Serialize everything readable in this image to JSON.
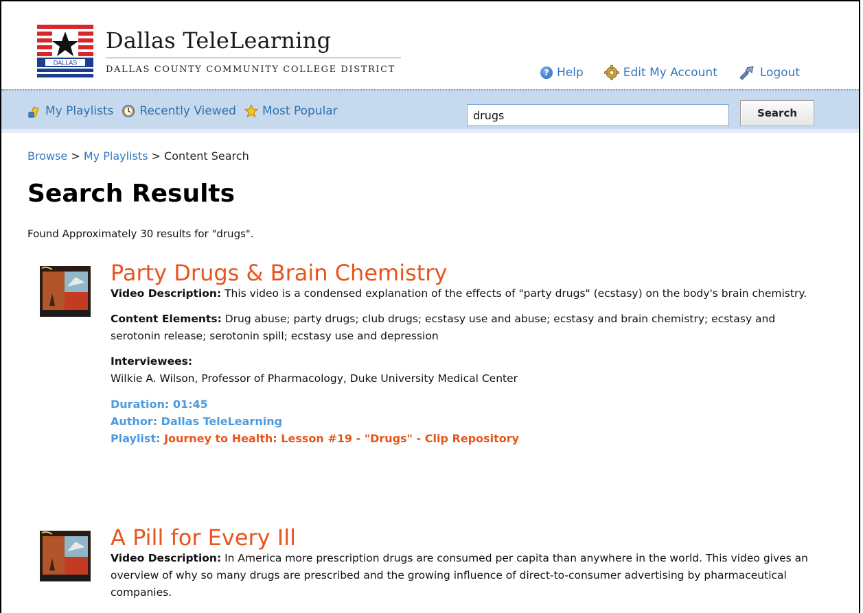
{
  "header": {
    "title": "Dallas TeleLearning",
    "subtitle": "DALLAS COUNTY COMMUNITY COLLEGE DISTRICT",
    "logo_text": "DALLAS",
    "links": [
      {
        "label": "Help",
        "icon": "help-icon"
      },
      {
        "label": "Edit My Account",
        "icon": "gear-icon"
      },
      {
        "label": "Logout",
        "icon": "logout-icon"
      }
    ]
  },
  "nav": {
    "links": [
      {
        "label": "My Playlists",
        "icon": "playlist-icon"
      },
      {
        "label": "Recently Viewed",
        "icon": "clock-icon"
      },
      {
        "label": "Most Popular",
        "icon": "star-icon"
      }
    ],
    "search_value": "drugs",
    "search_button": "Search"
  },
  "breadcrumb": {
    "items": [
      "Browse",
      "My Playlists",
      "Content Search"
    ],
    "separator": ">"
  },
  "page_title": "Search Results",
  "summary": "Found Approximately 30 results for \"drugs\".",
  "results": [
    {
      "title": "Party Drugs & Brain Chemistry",
      "desc_label": "Video Description:",
      "desc": "This video is a condensed explanation of the effects of \"party drugs\" (ecstasy) on the body's brain chemistry.",
      "content_label": "Content Elements:",
      "content": "Drug abuse; party drugs; club drugs; ecstasy use and abuse; ecstasy and brain chemistry; ecstasy and serotonin release; serotonin spill; ecstasy use and depression",
      "interviewees_label": "Interviewees:",
      "interviewees": "Wilkie A. Wilson, Professor of Pharmacology, Duke University Medical Center",
      "duration": "Duration: 01:45",
      "author": "Author: Dallas TeleLearning",
      "playlist_label": "Playlist:",
      "playlist": "Journey to Health: Lesson #19 - \"Drugs\" - Clip Repository"
    },
    {
      "title": "A Pill for Every Ill",
      "desc_label": "Video Description:",
      "desc": "In America more prescription drugs are consumed per capita than anywhere in the world. This video gives an overview of why so many drugs are prescribed and the growing influence of direct-to-consumer advertising by pharmaceutical companies."
    }
  ],
  "colors": {
    "link": "#2f78c0",
    "result_title": "#e8541c",
    "meta": "#4a9be0",
    "navbar": "#c7d9ec"
  }
}
